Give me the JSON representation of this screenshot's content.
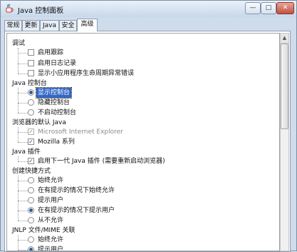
{
  "window": {
    "title": "Java 控制面板"
  },
  "window_buttons": {
    "min": "—",
    "max": "□",
    "close": "✕"
  },
  "tabs": [
    {
      "label": "常规"
    },
    {
      "label": "更新"
    },
    {
      "label": "Java"
    },
    {
      "label": "安全"
    },
    {
      "label": "高级",
      "active": true
    }
  ],
  "sections": {
    "debug": {
      "title": "调试",
      "items": [
        {
          "label": "启用跟踪",
          "checked": false
        },
        {
          "label": "启用日志记录",
          "checked": false
        },
        {
          "label": "显示小应用程序生命周期异常错误",
          "checked": false
        }
      ]
    },
    "console": {
      "title": "Java 控制台",
      "items": [
        {
          "label": "显示控制台",
          "selected": true
        },
        {
          "label": "隐藏控制台",
          "selected": false
        },
        {
          "label": "不启动控制台",
          "selected": false
        }
      ]
    },
    "browser": {
      "title": "浏览器的默认 Java",
      "items": [
        {
          "label": "Microsoft Internet Explorer",
          "checked": true,
          "disabled": true
        },
        {
          "label": "Mozilla 系列",
          "checked": true
        }
      ]
    },
    "plugin": {
      "title": "Java 插件",
      "items": [
        {
          "label": "启用下一代 Java 插件 (需要重新启动浏览器)",
          "checked": true
        }
      ]
    },
    "shortcut": {
      "title": "创建快捷方式",
      "items": [
        {
          "label": "始终允许",
          "selected": false
        },
        {
          "label": "在有提示的情况下始终允许",
          "selected": false
        },
        {
          "label": "提示用户",
          "selected": false
        },
        {
          "label": "在有提示的情况下提示用户",
          "selected": true
        },
        {
          "label": "从不允许",
          "selected": false
        }
      ]
    },
    "jnlp": {
      "title": "JNLP 文件/MIME 关联",
      "items": [
        {
          "label": "始终允许",
          "selected": false
        },
        {
          "label": "提示用户",
          "selected": true
        }
      ]
    }
  },
  "scrollbar": {
    "up_arrow": "▲"
  }
}
